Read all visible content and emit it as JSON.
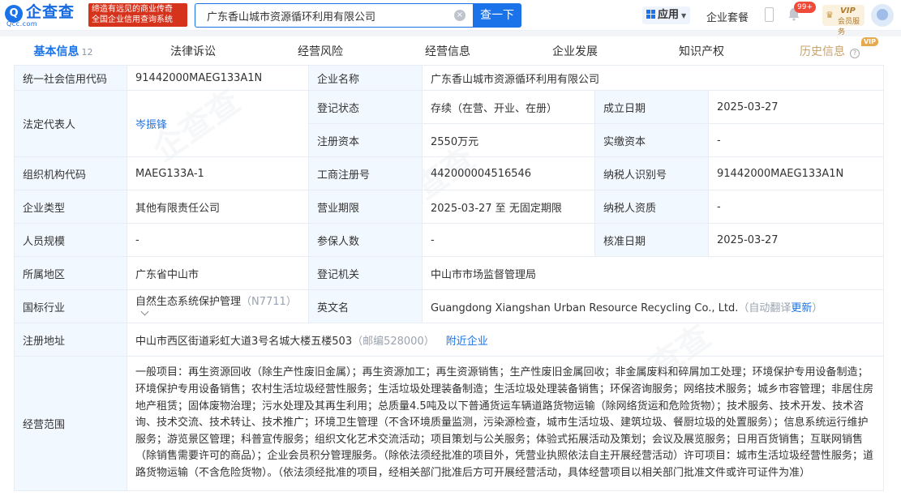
{
  "header": {
    "logo": {
      "text": "企查查",
      "sub": "Qcc.com"
    },
    "slogan": [
      "缔造有远见的商业传奇",
      "全国企业信用查询系统"
    ],
    "search": {
      "value": "广东香山城市资源循环利用有限公司",
      "clear": "×",
      "button": "查一下"
    },
    "app_menu": "应用",
    "package_link": "企业套餐",
    "notifications_badge": "99+",
    "vip": {
      "top": "VIP",
      "bottom": "会员服务"
    }
  },
  "tabs": [
    {
      "label": "基本信息",
      "count": "12"
    },
    {
      "label": "法律诉讼"
    },
    {
      "label": "经营风险"
    },
    {
      "label": "经营信息"
    },
    {
      "label": "企业发展"
    },
    {
      "label": "知识产权"
    },
    {
      "label": "历史信息",
      "tag": "VIP",
      "help": "?"
    }
  ],
  "info": {
    "credit_code": {
      "label": "统一社会信用代码",
      "value": "91442000MAEG133A1N"
    },
    "company_name": {
      "label": "企业名称",
      "value": "广东香山城市资源循环利用有限公司"
    },
    "legal_rep": {
      "label": "法定代表人",
      "value": "岑振锋"
    },
    "status": {
      "label": "登记状态",
      "value": "存续（在营、开业、在册）"
    },
    "established": {
      "label": "成立日期",
      "value": "2025-03-27"
    },
    "reg_capital": {
      "label": "注册资本",
      "value": "2550万元"
    },
    "paid_capital": {
      "label": "实缴资本",
      "value": "-"
    },
    "org_code": {
      "label": "组织机构代码",
      "value": "MAEG133A-1"
    },
    "biz_reg_no": {
      "label": "工商注册号",
      "value": "442000004516546"
    },
    "taxpayer_id": {
      "label": "纳税人识别号",
      "value": "91442000MAEG133A1N"
    },
    "company_type": {
      "label": "企业类型",
      "value": "其他有限责任公司"
    },
    "biz_term": {
      "label": "营业期限",
      "value": "2025-03-27 至 无固定期限"
    },
    "taxpayer_qual": {
      "label": "纳税人资质",
      "value": "-"
    },
    "staff_size": {
      "label": "人员规模",
      "value": "-"
    },
    "insured": {
      "label": "参保人数",
      "value": "-"
    },
    "approval_date": {
      "label": "核准日期",
      "value": "2025-03-27"
    },
    "region": {
      "label": "所属地区",
      "value": "广东省中山市"
    },
    "reg_authority": {
      "label": "登记机关",
      "value": "中山市市场监督管理局"
    },
    "industry": {
      "label": "国标行业",
      "value": "自然生态系统保护管理",
      "code": "（N7711）"
    },
    "english_name": {
      "label": "英文名",
      "value": "Guangdong Xiangshan Urban Resource Recycling Co., Ltd.",
      "auto": "（自动翻译",
      "update": "更新",
      "close": "）"
    },
    "address": {
      "label": "注册地址",
      "value": "中山市西区街道彩虹大道3号名城大楼五楼503",
      "postcode": "（邮编528000）",
      "nearby": "附近企业"
    },
    "scope": {
      "label": "经营范围",
      "value": "一般项目：再生资源回收（除生产性废旧金属）；再生资源加工；再生资源销售；生产性废旧金属回收；非金属废料和碎屑加工处理；环境保护专用设备制造；环境保护专用设备销售；农村生活垃圾经营性服务；生活垃圾处理装备制造；生活垃圾处理装备销售；环保咨询服务；网络技术服务；城乡市容管理；非居住房地产租赁；固体废物治理；污水处理及其再生利用；总质量4.5吨及以下普通货运车辆道路货物运输（除网络货运和危险货物）；技术服务、技术开发、技术咨询、技术交流、技术转让、技术推广；环境卫生管理（不含环境质量监测，污染源检查，城市生活垃圾、建筑垃圾、餐厨垃圾的处置服务）；信息系统运行维护服务；游览景区管理；科普宣传服务；组织文化艺术交流活动；项目策划与公关服务；体验式拓展活动及策划；会议及展览服务；日用百货销售；互联网销售（除销售需要许可的商品）；企业会员积分管理服务。（除依法须经批准的项目外，凭营业执照依法自主开展经营活动）许可项目：城市生活垃圾经营性服务；道路货物运输（不含危险货物）。（依法须经批准的项目，经相关部门批准后方可开展经营活动，具体经营项目以相关部门批准文件或许可证件为准）"
    }
  },
  "watermark": "企查查"
}
